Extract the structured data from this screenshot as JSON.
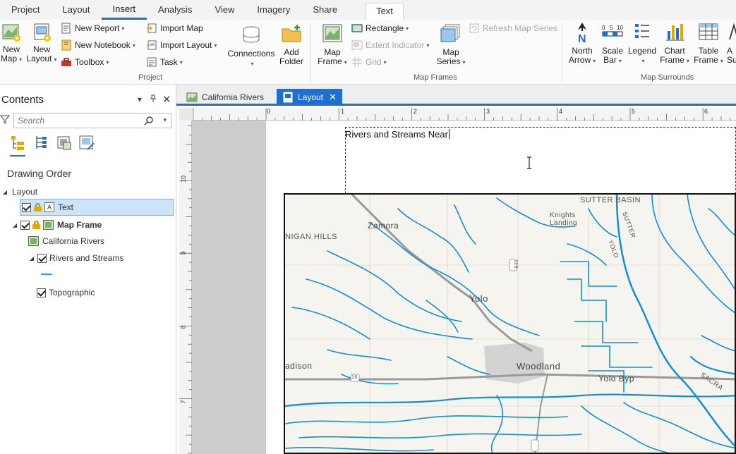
{
  "menu_tabs": [
    {
      "label": "Project"
    },
    {
      "label": "Layout"
    },
    {
      "label": "Insert"
    },
    {
      "label": "Analysis"
    },
    {
      "label": "View"
    },
    {
      "label": "Imagery"
    },
    {
      "label": "Share"
    },
    {
      "label": "Text"
    }
  ],
  "ribbon": {
    "project": {
      "new_map": [
        "New",
        "Map"
      ],
      "new_layout": [
        "New",
        "Layout"
      ],
      "new_report": "New Report",
      "new_notebook": "New Notebook",
      "toolbox": "Toolbox",
      "import_map": "Import Map",
      "import_layout": "Import Layout",
      "task": "Task",
      "connections": "Connections",
      "add_folder": [
        "Add",
        "Folder"
      ],
      "group_label": "Project"
    },
    "map_frames": {
      "map_frame": [
        "Map",
        "Frame"
      ],
      "rectangle": "Rectangle",
      "extent_indicator": "Extent Indicator",
      "grid": "Grid",
      "map_series": [
        "Map",
        "Series"
      ],
      "refresh_map_series": "Refresh Map Series",
      "group_label": "Map Frames"
    },
    "map_surrounds": {
      "north_arrow": [
        "North",
        "Arrow"
      ],
      "scale_bar": [
        "Scale",
        "Bar"
      ],
      "legend": "Legend",
      "chart_frame": [
        "Chart",
        "Frame"
      ],
      "table_frame": [
        "Table",
        "Frame"
      ],
      "add_partial": [
        "A",
        "Su"
      ],
      "scale_numbers": [
        "0",
        "5",
        "10"
      ],
      "group_label": "Map Surrounds"
    }
  },
  "contents": {
    "title": "Contents",
    "search_placeholder": "Search",
    "heading": "Drawing Order",
    "tree": {
      "layout": "Layout",
      "text": "Text",
      "map_frame": "Map Frame",
      "map": "California Rivers",
      "layer_streams": "Rivers and Streams",
      "layer_topo": "Topographic"
    },
    "colors": {
      "stream": "#1aa3e8",
      "selection": "#cce4f7"
    }
  },
  "doc_tabs": [
    {
      "label": "California Rivers"
    },
    {
      "label": "Layout"
    }
  ],
  "ruler": {
    "top": [
      "0",
      "1",
      "2",
      "3",
      "4",
      "5",
      "6"
    ],
    "left": [
      "10",
      "9",
      "8",
      "7"
    ]
  },
  "layout": {
    "text_element": "Rivers and Streams Near"
  },
  "map": {
    "labels": {
      "sutter_basin": "SUTTER BASIN",
      "knights_landing": [
        "Knights",
        "Landing"
      ],
      "zamora": "Zamora",
      "dunnigan_hills": "NIGAN HILLS",
      "yolo": "Yolo",
      "woodland": "Woodland",
      "yolo_bypass": "Yolo Byp",
      "madison": "adison",
      "hwy_113": "113",
      "hwy_16": "16",
      "sacramento": "SACRA",
      "sutter": "SUTTER",
      "yolo_vertical": "YOLO"
    },
    "colors": {
      "river": "#0f8fd6",
      "land": "#f5f4ee",
      "road": "#9a9a9a",
      "urban": "#cfcfcf"
    }
  }
}
